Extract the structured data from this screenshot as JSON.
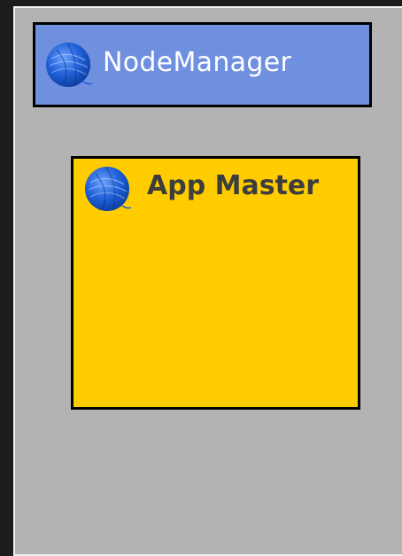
{
  "node_manager": {
    "title": "NodeManager",
    "icon": "yarn-ball-icon"
  },
  "app_master": {
    "title": "App Master",
    "icon": "yarn-ball-icon"
  },
  "colors": {
    "background": "#1c1c1c",
    "panel": "#b3b3b3",
    "panel_border": "#f2f2f2",
    "node_manager_fill": "#6f8fdf",
    "app_master_fill": "#ffcc00",
    "yarn_blue": "#1f5fd6"
  }
}
